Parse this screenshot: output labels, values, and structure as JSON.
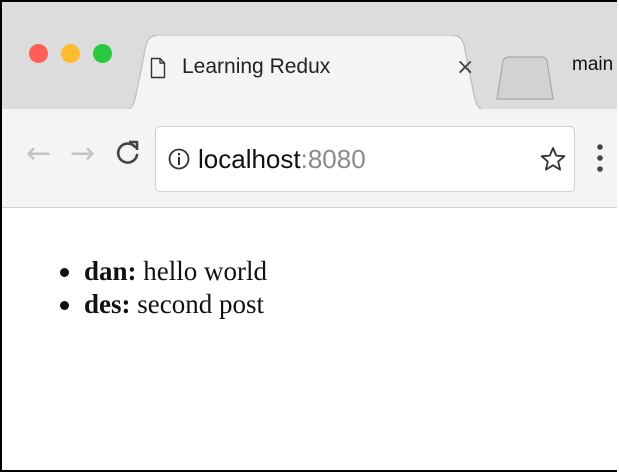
{
  "window": {
    "traffic_lights": [
      "close",
      "minimize",
      "zoom"
    ],
    "colors": {
      "close": "#ff5f57",
      "minimize": "#febc2e",
      "zoom": "#28c840"
    }
  },
  "tabs": {
    "active": {
      "title": "Learning Redux",
      "icon": "page-icon",
      "close_glyph": "×"
    },
    "new_tab_icon": "new-tab-icon",
    "profile_label": "main"
  },
  "toolbar": {
    "back_glyph": "←",
    "forward_glyph": "→",
    "reload_glyph": "C",
    "address": {
      "host": "localhost",
      "port": ":8080",
      "security_icon": "info-icon",
      "bookmark_icon": "star-icon"
    },
    "menu_icon": "more-vert-icon"
  },
  "page": {
    "posts": [
      {
        "author": "dan:",
        "text": " hello world"
      },
      {
        "author": "des:",
        "text": " second post"
      }
    ]
  }
}
